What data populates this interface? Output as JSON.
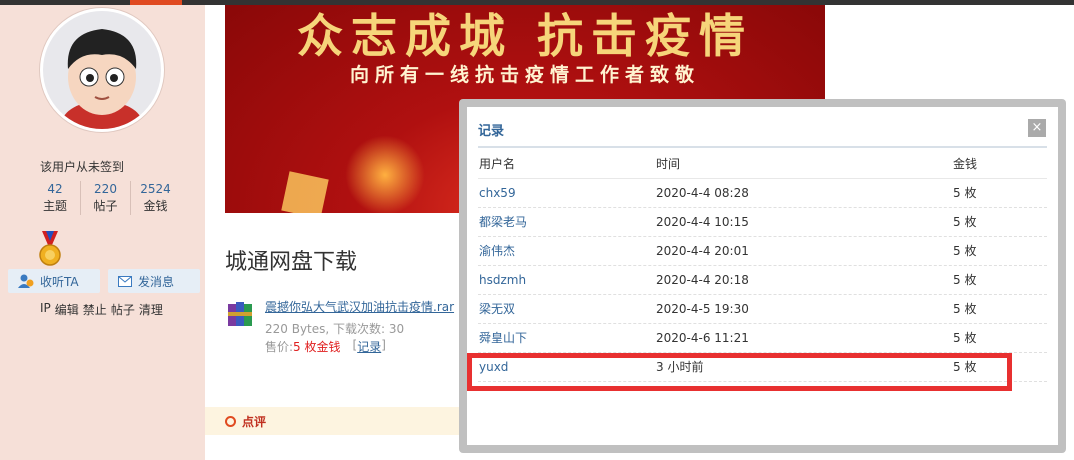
{
  "sidebar": {
    "signin_status": "该用户从未签到",
    "stats": [
      {
        "value": "42",
        "label": "主题"
      },
      {
        "value": "220",
        "label": "帖子"
      },
      {
        "value": "2524",
        "label": "金钱"
      }
    ],
    "follow_label": "收听TA",
    "message_label": "发消息",
    "admin_links": [
      "IP",
      "编辑",
      "禁止",
      "帖子",
      "清理"
    ]
  },
  "banner": {
    "title": "众志成城 抗击疫情",
    "subtitle": "向所有一线抗击疫情工作者致敬"
  },
  "post": {
    "title": "城通网盘下载",
    "attachment": {
      "filename": "震撼你弘大气武汉加油抗击疫情.rar",
      "meta": "220 Bytes, 下载次数: 30",
      "price_label": "售价: ",
      "price_value": "5 枚金钱",
      "record_label": "记录",
      "bracket_open": "[",
      "bracket_close": "]"
    }
  },
  "comment": {
    "label": "点评"
  },
  "dialog": {
    "title": "记录",
    "close_label": "×",
    "columns": [
      "用户名",
      "时间",
      "金钱"
    ],
    "rows": [
      {
        "user": "chx59",
        "time": "2020-4-4 08:28",
        "money": "5 枚"
      },
      {
        "user": "都梁老马",
        "time": "2020-4-4 10:15",
        "money": "5 枚"
      },
      {
        "user": "渝伟杰",
        "time": "2020-4-4 20:01",
        "money": "5 枚"
      },
      {
        "user": "hsdzmh",
        "time": "2020-4-4 20:18",
        "money": "5 枚"
      },
      {
        "user": "梁无双",
        "time": "2020-4-5 19:30",
        "money": "5 枚"
      },
      {
        "user": "舜皇山下",
        "time": "2020-4-6 11:21",
        "money": "5 枚"
      },
      {
        "user": "yuxd",
        "time": "3 小时前",
        "money": "5 枚"
      }
    ]
  },
  "colors": {
    "link": "#336699",
    "highlight": "#e83030",
    "sidebar_bg": "#f6e0d8"
  }
}
